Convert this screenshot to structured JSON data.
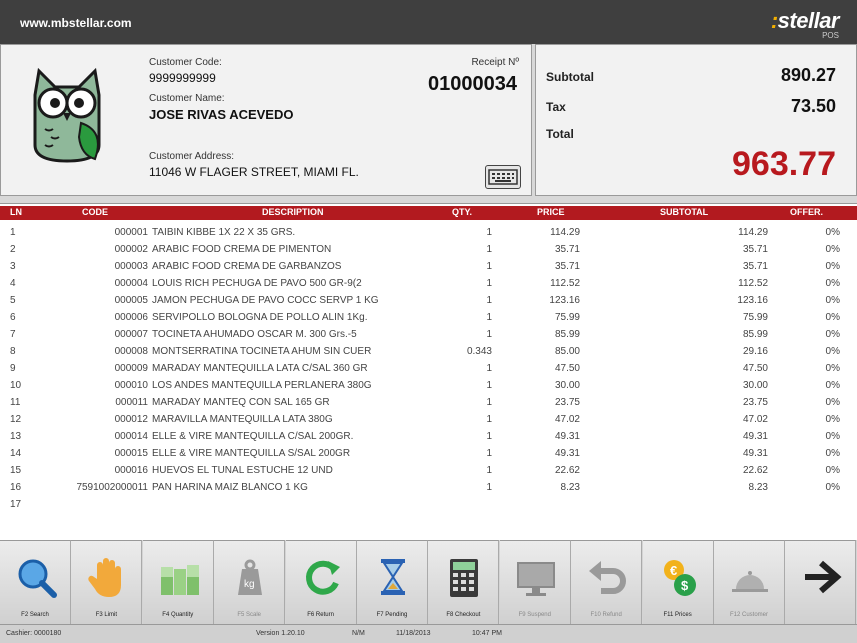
{
  "header": {
    "url": "www.mbstellar.com",
    "brand": "stellar",
    "brand_sub": "POS"
  },
  "customer": {
    "code_label": "Customer Code:",
    "code": "9999999999",
    "name_label": "Customer Name:",
    "name": "JOSE RIVAS ACEVEDO",
    "address_label": "Customer Address:",
    "address": "11046 W FLAGER STREET, MIAMI FL.",
    "receipt_label": "Receipt Nº",
    "receipt_no": "01000034"
  },
  "totals": {
    "subtotal_label": "Subtotal",
    "subtotal": "890.27",
    "tax_label": "Tax",
    "tax": "73.50",
    "total_label": "Total",
    "total": "963.77"
  },
  "grid": {
    "headers": {
      "ln": "LN",
      "code": "CODE",
      "desc": "DESCRIPTION",
      "qty": "QTY.",
      "price": "PRICE",
      "sub": "SUBTOTAL",
      "off": "OFFER."
    },
    "rows": [
      {
        "ln": "1",
        "code": "000001",
        "desc": "TAIBIN KIBBE 1X 22 X 35  GRS.",
        "qty": "1",
        "price": "114.29",
        "sub": "114.29",
        "off": "0%"
      },
      {
        "ln": "2",
        "code": "000002",
        "desc": "ARABIC FOOD CREMA DE PIMENTON",
        "qty": "1",
        "price": "35.71",
        "sub": "35.71",
        "off": "0%"
      },
      {
        "ln": "3",
        "code": "000003",
        "desc": "ARABIC FOOD CREMA DE GARBANZOS",
        "qty": "1",
        "price": "35.71",
        "sub": "35.71",
        "off": "0%"
      },
      {
        "ln": "4",
        "code": "000004",
        "desc": "LOUIS RICH PECHUGA DE PAVO 500 GR-9(2",
        "qty": "1",
        "price": "112.52",
        "sub": "112.52",
        "off": "0%"
      },
      {
        "ln": "5",
        "code": "000005",
        "desc": "JAMON PECHUGA DE PAVO COCC SERVP 1 KG",
        "qty": "1",
        "price": "123.16",
        "sub": "123.16",
        "off": "0%"
      },
      {
        "ln": "6",
        "code": "000006",
        "desc": "SERVIPOLLO BOLOGNA DE POLLO ALIN 1Kg.",
        "qty": "1",
        "price": "75.99",
        "sub": "75.99",
        "off": "0%"
      },
      {
        "ln": "7",
        "code": "000007",
        "desc": "TOCINETA  AHUMADO OSCAR M. 300 Grs.-5",
        "qty": "1",
        "price": "85.99",
        "sub": "85.99",
        "off": "0%"
      },
      {
        "ln": "8",
        "code": "000008",
        "desc": "MONTSERRATINA TOCINETA AHUM SIN CUER",
        "qty": "0.343",
        "price": "85.00",
        "sub": "29.16",
        "off": "0%"
      },
      {
        "ln": "9",
        "code": "000009",
        "desc": "MARADAY  MANTEQUILLA  LATA  C/SAL 360 GR",
        "qty": "1",
        "price": "47.50",
        "sub": "47.50",
        "off": "0%"
      },
      {
        "ln": "10",
        "code": "000010",
        "desc": "LOS ANDES MANTEQUILLA PERLANERA 380G",
        "qty": "1",
        "price": "30.00",
        "sub": "30.00",
        "off": "0%"
      },
      {
        "ln": "11",
        "code": "000011",
        "desc": "MARADAY  MANTEQ CON SAL 165  GR",
        "qty": "1",
        "price": "23.75",
        "sub": "23.75",
        "off": "0%"
      },
      {
        "ln": "12",
        "code": "000012",
        "desc": "MARAVILLA MANTEQUILLA LATA 380G",
        "qty": "1",
        "price": "47.02",
        "sub": "47.02",
        "off": "0%"
      },
      {
        "ln": "13",
        "code": "000014",
        "desc": "ELLE & VIRE MANTEQUILLA C/SAL 200GR.",
        "qty": "1",
        "price": "49.31",
        "sub": "49.31",
        "off": "0%"
      },
      {
        "ln": "14",
        "code": "000015",
        "desc": "ELLE & VIRE MANTEQUILLA S/SAL 200GR",
        "qty": "1",
        "price": "49.31",
        "sub": "49.31",
        "off": "0%"
      },
      {
        "ln": "15",
        "code": "000016",
        "desc": "HUEVOS EL TUNAL ESTUCHE 12 UND",
        "qty": "1",
        "price": "22.62",
        "sub": "22.62",
        "off": "0%"
      },
      {
        "ln": "16",
        "code": "7591002000011",
        "desc": "PAN HARINA MAIZ BLANCO 1 KG",
        "qty": "1",
        "price": "8.23",
        "sub": "8.23",
        "off": "0%"
      },
      {
        "ln": "17",
        "code": "",
        "desc": "",
        "qty": "",
        "price": "",
        "sub": "",
        "off": ""
      }
    ]
  },
  "buttons": [
    {
      "label": "F2 Search",
      "icon": "magnifier-icon",
      "name": "search-button",
      "enabled": true
    },
    {
      "label": "F3  Limit",
      "icon": "hand-icon",
      "name": "limit-button",
      "enabled": true
    },
    {
      "label": "F4 Quantity",
      "icon": "boxes-icon",
      "name": "quantity-button",
      "enabled": true
    },
    {
      "label": "F5 Scale",
      "icon": "weight-icon",
      "name": "scale-button",
      "enabled": false
    },
    {
      "label": "F6 Return",
      "icon": "refresh-icon",
      "name": "return-button",
      "enabled": true
    },
    {
      "label": "F7 Pending",
      "icon": "hourglass-icon",
      "name": "pending-button",
      "enabled": true
    },
    {
      "label": "F8 Checkout",
      "icon": "calculator-icon",
      "name": "checkout-button",
      "enabled": true
    },
    {
      "label": "F9 Suspend",
      "icon": "monitor-icon",
      "name": "suspend-button",
      "enabled": false
    },
    {
      "label": "F10 Refund",
      "icon": "undo-icon",
      "name": "refund-button",
      "enabled": false
    },
    {
      "label": "F11 Prices",
      "icon": "coins-icon",
      "name": "prices-button",
      "enabled": true
    },
    {
      "label": "F12 Customer",
      "icon": "cloche-icon",
      "name": "customer-button",
      "enabled": false
    },
    {
      "label": "",
      "icon": "arrow-right-icon",
      "name": "next-button",
      "enabled": true
    }
  ],
  "status": {
    "cashier": "Cashier: 0000180",
    "version": "Version 1.20.10",
    "mode": "N/M",
    "date": "11/18/2013",
    "time": "10:47 PM"
  },
  "colors": {
    "accent": "#b21a1f",
    "total": "#b8191e",
    "topbar": "#3f3f3f"
  }
}
